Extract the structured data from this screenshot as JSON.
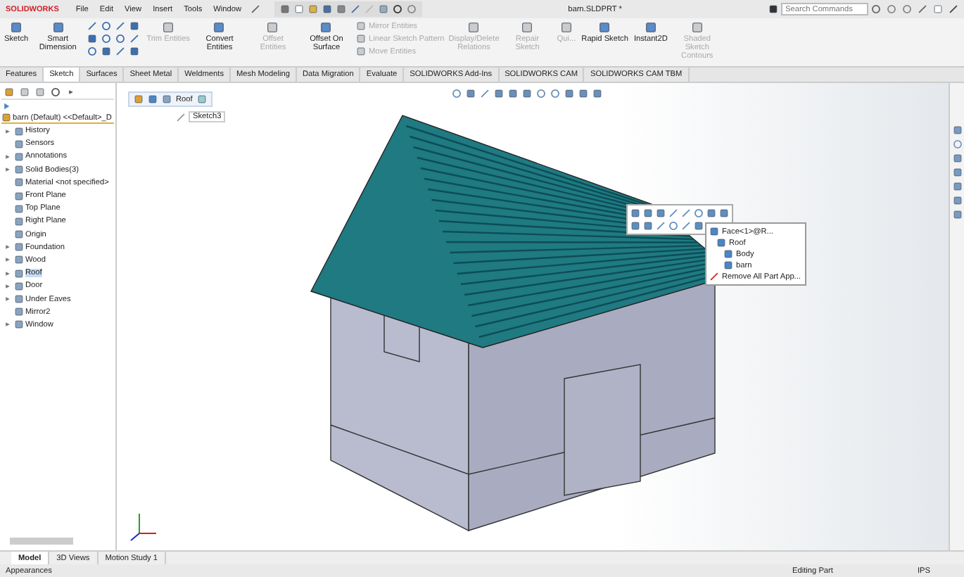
{
  "title_bar": {
    "logo": "SOLIDWORKS",
    "menus": [
      "File",
      "Edit",
      "View",
      "Insert",
      "Tools",
      "Window"
    ],
    "document_title": "barn.SLDPRT *",
    "search": {
      "placeholder": "Search Commands"
    }
  },
  "ribbon": [
    {
      "kind": "big",
      "label": "Sketch",
      "disabled": false
    },
    {
      "kind": "big",
      "label": "Smart Dimension",
      "disabled": false
    },
    {
      "kind": "tools"
    },
    {
      "kind": "big",
      "label": "Trim Entities",
      "disabled": true
    },
    {
      "kind": "big",
      "label": "Convert Entities",
      "disabled": false
    },
    {
      "kind": "big",
      "label": "Offset Entities",
      "disabled": true
    },
    {
      "kind": "big",
      "label": "Offset On Surface",
      "disabled": false
    },
    {
      "kind": "stack",
      "items": [
        {
          "label": "Mirror Entities",
          "disabled": true
        },
        {
          "label": "Linear Sketch Pattern",
          "disabled": true
        },
        {
          "label": "Move Entities",
          "disabled": true
        }
      ]
    },
    {
      "kind": "big",
      "label": "Display/Delete Relations",
      "disabled": true
    },
    {
      "kind": "big",
      "label": "Repair Sketch",
      "disabled": true
    },
    {
      "kind": "big",
      "label": "Qui...",
      "disabled": true
    },
    {
      "kind": "big",
      "label": "Rapid Sketch",
      "disabled": false
    },
    {
      "kind": "big",
      "label": "Instant2D",
      "disabled": false
    },
    {
      "kind": "big",
      "label": "Shaded Sketch Contours",
      "disabled": true
    }
  ],
  "tabs": [
    {
      "label": "Features",
      "selected": false
    },
    {
      "label": "Sketch",
      "selected": true
    },
    {
      "label": "Surfaces",
      "selected": false
    },
    {
      "label": "Sheet Metal",
      "selected": false
    },
    {
      "label": "Weldments",
      "selected": false
    },
    {
      "label": "Mesh Modeling",
      "selected": false
    },
    {
      "label": "Data Migration",
      "selected": false
    },
    {
      "label": "Evaluate",
      "selected": false
    },
    {
      "label": "SOLIDWORKS Add-Ins",
      "selected": false
    },
    {
      "label": "SOLIDWORKS CAM",
      "selected": false
    },
    {
      "label": "SOLIDWORKS CAM TBM",
      "selected": false
    }
  ],
  "feature_tree": {
    "root": "barn (Default) <<Default>_D",
    "items": [
      {
        "label": "History",
        "kind": "group",
        "selected": false
      },
      {
        "label": "Sensors",
        "kind": "leaf",
        "selected": false
      },
      {
        "label": "Annotations",
        "kind": "group",
        "selected": false
      },
      {
        "label": "Solid Bodies(3)",
        "kind": "group",
        "selected": false
      },
      {
        "label": "Material <not specified>",
        "kind": "leaf",
        "selected": false
      },
      {
        "label": "Front Plane",
        "kind": "leaf",
        "selected": false
      },
      {
        "label": "Top Plane",
        "kind": "leaf",
        "selected": false
      },
      {
        "label": "Right Plane",
        "kind": "leaf",
        "selected": false
      },
      {
        "label": "Origin",
        "kind": "leaf",
        "selected": false
      },
      {
        "label": "Foundation",
        "kind": "group",
        "selected": false
      },
      {
        "label": "Wood",
        "kind": "group",
        "selected": false
      },
      {
        "label": "Roof",
        "kind": "group",
        "selected": true
      },
      {
        "label": "Door",
        "kind": "group",
        "selected": false
      },
      {
        "label": "Under Eaves",
        "kind": "group",
        "selected": false
      },
      {
        "label": "Mirror2",
        "kind": "leaf",
        "selected": false
      },
      {
        "label": "Window",
        "kind": "group",
        "selected": false
      }
    ]
  },
  "viewport": {
    "breadcrumb": "Roof",
    "sketch_label": "Sketch3",
    "context_menu": {
      "items": [
        {
          "label": "Face<1>@R...",
          "children": [
            {
              "label": "Roof",
              "children": [
                {
                  "label": "Body"
                },
                {
                  "label": "barn"
                }
              ]
            }
          ]
        }
      ],
      "action": "Remove All Part App..."
    }
  },
  "bottom_tabs": [
    {
      "label": "Model",
      "selected": true
    },
    {
      "label": "3D Views",
      "selected": false
    },
    {
      "label": "Motion Study 1",
      "selected": false
    }
  ],
  "status_bar": {
    "left": "Appearances",
    "mode": "Editing Part",
    "units": "IPS"
  }
}
